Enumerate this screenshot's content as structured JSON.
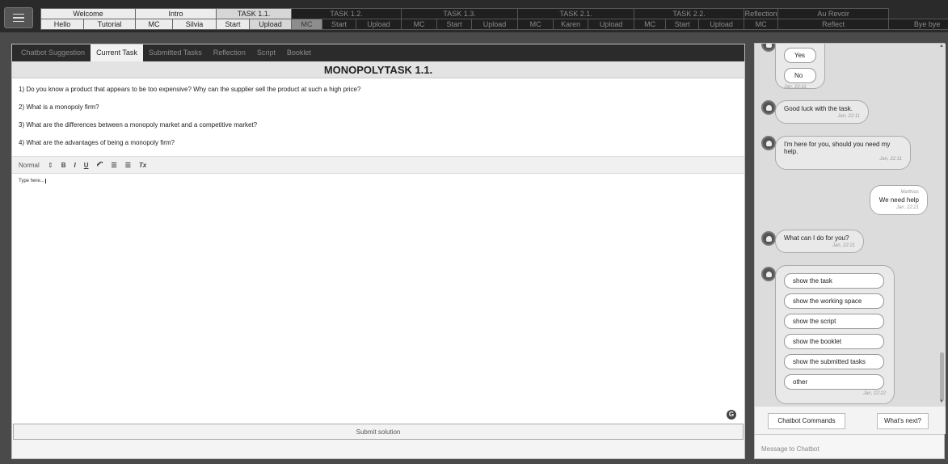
{
  "nav": {
    "top": [
      {
        "label": "Welcome",
        "span": 2,
        "style": "lt"
      },
      {
        "label": "Intro",
        "span": 2,
        "style": "lt"
      },
      {
        "label": "TASK 1.1.",
        "span": 2,
        "style": "lt sel"
      },
      {
        "label": "TASK 1.2.",
        "span": 3,
        "style": "dk"
      },
      {
        "label": "TASK 1.3.",
        "span": 3,
        "style": "dk"
      },
      {
        "label": "TASK 2.1.",
        "span": 3,
        "style": "dk"
      },
      {
        "label": "TASK 2.2.",
        "span": 3,
        "style": "dk"
      },
      {
        "label": "Reflection",
        "span": 1,
        "style": "dk"
      },
      {
        "label": "Au Revoir",
        "span": 1,
        "style": "dk"
      }
    ],
    "bottom": [
      {
        "label": "Hello",
        "style": "lt"
      },
      {
        "label": "Tutorial",
        "style": "lt"
      },
      {
        "label": "MC",
        "style": "lt"
      },
      {
        "label": "Silvia",
        "style": "lt"
      },
      {
        "label": "Start",
        "style": "lt"
      },
      {
        "label": "Upload",
        "style": "lt sel"
      },
      {
        "label": "MC",
        "style": "md"
      },
      {
        "label": "Start",
        "style": "dk"
      },
      {
        "label": "Upload",
        "style": "dk"
      },
      {
        "label": "MC",
        "style": "dk"
      },
      {
        "label": "Start",
        "style": "dk"
      },
      {
        "label": "Upload",
        "style": "dk"
      },
      {
        "label": "MC",
        "style": "dk"
      },
      {
        "label": "Karen",
        "style": "dk"
      },
      {
        "label": "Upload",
        "style": "dk"
      },
      {
        "label": "MC",
        "style": "dk"
      },
      {
        "label": "Start",
        "style": "dk"
      },
      {
        "label": "Upload",
        "style": "dk"
      },
      {
        "label": "MC",
        "style": "dk"
      },
      {
        "label": "Reflect",
        "style": "dk"
      },
      {
        "label": "Bye bye",
        "style": "dk"
      }
    ]
  },
  "tabs": [
    {
      "label": "Chatbot Suggestion",
      "active": false
    },
    {
      "label": "Current Task",
      "active": true
    },
    {
      "label": "Submitted Tasks",
      "active": false
    },
    {
      "label": "Reflection",
      "active": false
    },
    {
      "label": "Script",
      "active": false
    },
    {
      "label": "Booklet",
      "active": false
    }
  ],
  "task": {
    "title": "MONOPOLYTASK 1.1.",
    "questions": [
      "1) Do you know a product that appears to be too expensive? Why can the supplier sell the product at such a high price?",
      "2) What is a monopoly firm?",
      "3) What are the differences between a monopoly market and a competitive market?",
      "4) What are the advantages of being a monopoly firm?"
    ]
  },
  "toolbar": {
    "format": "Normal",
    "format_arrows": "⇕",
    "bold": "B",
    "italic": "I",
    "underline": "U",
    "link": "🔗",
    "ordered_list": "☰",
    "bullet_list": "☰",
    "clear": "Tx"
  },
  "editor": {
    "placeholder": "Type here...",
    "grammarly": "G"
  },
  "submit_label": "Submit solution",
  "chat": {
    "quick_replies_top": [
      "Yes",
      "No"
    ],
    "quick_replies_top_time": "Jan, 22:11",
    "messages": [
      {
        "text": "Good luck with the task.",
        "time": "Jan, 22:11"
      },
      {
        "text": "I'm here for you, should you need my help.",
        "time": "Jan, 22:11"
      },
      {
        "sender": "Matthias",
        "text": "We need help",
        "time": "Jan, 22:21"
      },
      {
        "text": "What can I do for you?",
        "time": "Jan, 22:21"
      }
    ],
    "options": [
      "show the task",
      "show the working space",
      "show the script",
      "show the booklet",
      "show the submitted tasks",
      "other"
    ],
    "options_time": "Jan, 22:22",
    "commands_label": "Chatbot Commands",
    "next_label": "What's next?",
    "input_placeholder": "Message to Chatbot"
  }
}
